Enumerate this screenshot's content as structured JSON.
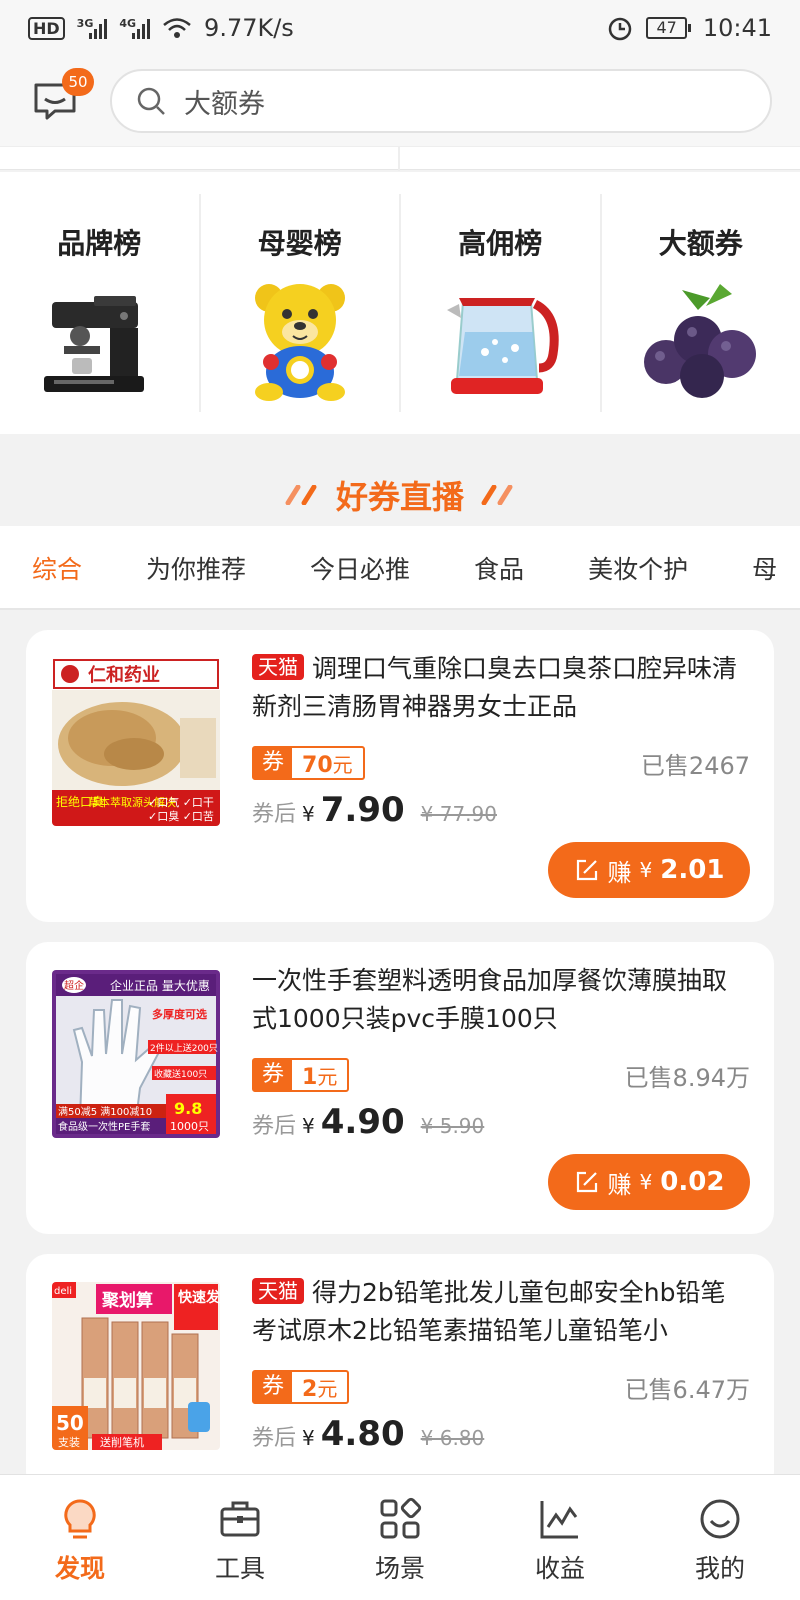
{
  "status_bar": {
    "hd": "HD",
    "sim2": "2",
    "net1": "3G",
    "net2": "4G",
    "speed": "9.77K/s",
    "battery": "47",
    "time": "10:41"
  },
  "header": {
    "message_badge": "50",
    "search_placeholder": "大额券"
  },
  "categories": [
    {
      "title": "品牌榜",
      "image": "coffee-machine"
    },
    {
      "title": "母婴榜",
      "image": "toy-bear"
    },
    {
      "title": "高佣榜",
      "image": "electric-kettle"
    },
    {
      "title": "大额券",
      "image": "plums"
    }
  ],
  "section": {
    "title": "好券直播"
  },
  "tabs": [
    "综合",
    "为你推荐",
    "今日必推",
    "食品",
    "美妆个护",
    "母"
  ],
  "products": [
    {
      "tag": "天猫",
      "title": "调理口气重除口臭去口臭茶口腔异味清新剂三清肠胃神器男女士正品",
      "coupon_label": "券",
      "coupon_amount": "70",
      "coupon_unit": "元",
      "sold": "已售2467",
      "price_label": "券后",
      "currency": "¥",
      "price": "7.90",
      "original_price": "¥ 77.90",
      "earn_label": "赚",
      "earn_amount": "2.01",
      "thumb": {
        "brand": "仁和药业",
        "tag1": "拒绝口臭",
        "tag2": "草本萃取源头解决",
        "tag3": "✓口气 ✓口干",
        "tag4": "✓口臭 ✓口苦"
      }
    },
    {
      "tag": "",
      "title": "一次性手套塑料透明食品加厚餐饮薄膜抽取式1000只装pvc手膜100只",
      "coupon_label": "券",
      "coupon_amount": "1",
      "coupon_unit": "元",
      "sold": "已售8.94万",
      "price_label": "券后",
      "currency": "¥",
      "price": "4.90",
      "original_price": "¥ 5.90",
      "earn_label": "赚",
      "earn_amount": "0.02",
      "thumb": {
        "brand": "超企",
        "top": "企业正品 量大优惠",
        "hint1": "多厚度可选",
        "hint2": "2件以上送200只",
        "hint3": "收藏送100只",
        "promo": "满50减5 满100减10",
        "price": "9.8",
        "qty": "1000只",
        "bottom": "食品级一次性PE手套"
      }
    },
    {
      "tag": "天猫",
      "title": "得力2b铅笔批发儿童包邮安全hb铅笔考试原木2比铅笔素描铅笔儿童铅笔小",
      "coupon_label": "券",
      "coupon_amount": "2",
      "coupon_unit": "元",
      "sold": "已售6.47万",
      "price_label": "券后",
      "currency": "¥",
      "price": "4.80",
      "original_price": "¥ 6.80",
      "earn_label": "赚",
      "earn_amount": "",
      "thumb": {
        "brand": "deli",
        "banner": "聚划算",
        "ship": "快速发货",
        "count": "50",
        "unit": "支装",
        "gift": "送削笔机"
      }
    }
  ],
  "bottom_nav": [
    {
      "label": "发现",
      "icon": "bulb-icon",
      "active": true
    },
    {
      "label": "工具",
      "icon": "briefcase-icon"
    },
    {
      "label": "场景",
      "icon": "grid-icon"
    },
    {
      "label": "收益",
      "icon": "chart-icon"
    },
    {
      "label": "我的",
      "icon": "smile-icon"
    }
  ],
  "colors": {
    "accent": "#f36a1a",
    "tmall": "#e4211d"
  }
}
